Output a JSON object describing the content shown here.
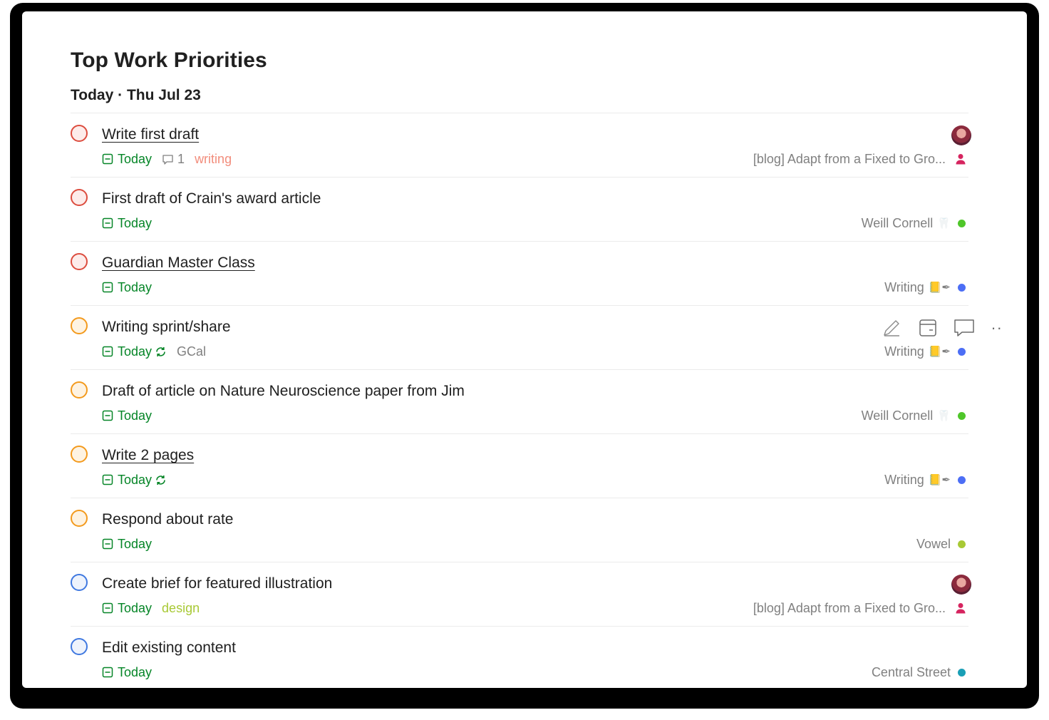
{
  "header": {
    "title": "Top Work Priorities",
    "subtitle": "Today · Thu Jul 23"
  },
  "colors": {
    "priority1": "#dc4c3e",
    "priority2": "#f39a1d",
    "priority3": "#3f78e0",
    "due_green": "#058527",
    "label_writing": "#f28d7c",
    "label_design": "#a8c935"
  },
  "tasks": [
    {
      "title": "Write first draft",
      "due": "Today",
      "comments": "1",
      "label": "writing",
      "project": "[blog] Adapt from a Fixed to Gro...",
      "priority": "p1"
    },
    {
      "title": "First draft of Crain's award article",
      "due": "Today",
      "project": "Weill Cornell",
      "project_emoji": "🦷",
      "priority": "p1"
    },
    {
      "title": "Guardian Master Class",
      "due": "Today",
      "project": "Writing",
      "project_emoji": "📒✒",
      "priority": "p1"
    },
    {
      "title": "Writing sprint/share",
      "due": "Today",
      "recurring": true,
      "extra": "GCal",
      "project": "Writing",
      "project_emoji": "📒✒",
      "priority": "p2"
    },
    {
      "title": "Draft of article on Nature Neuroscience paper from Jim",
      "due": "Today",
      "project": "Weill Cornell",
      "project_emoji": "🦷",
      "priority": "p2"
    },
    {
      "title": "Write 2 pages",
      "due": "Today",
      "recurring": true,
      "project": "Writing",
      "project_emoji": "📒✒",
      "priority": "p2"
    },
    {
      "title": "Respond about rate",
      "due": "Today",
      "project": "Vowel",
      "priority": "p2"
    },
    {
      "title": "Create brief for featured illustration",
      "due": "Today",
      "label": "design",
      "project": "[blog] Adapt from a Fixed to Gro...",
      "priority": "p3"
    },
    {
      "title": "Edit existing content",
      "due": "Today",
      "project": "Central Street",
      "priority": "p3"
    }
  ],
  "hover_actions": [
    "edit-icon",
    "schedule-icon",
    "comment-icon",
    "more-icon"
  ],
  "more_label": "··"
}
